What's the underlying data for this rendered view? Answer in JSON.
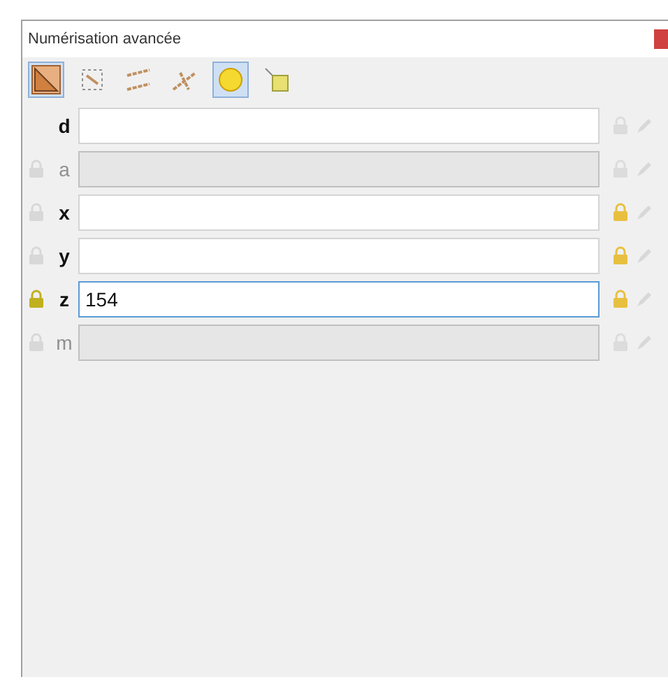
{
  "window": {
    "title": "Numérisation avancée"
  },
  "toolbar": [
    {
      "kind": "ruler",
      "selected": true
    },
    {
      "kind": "dashed",
      "selected": false
    },
    {
      "kind": "parallel",
      "selected": false
    },
    {
      "kind": "perpendicular",
      "selected": false
    },
    {
      "kind": "bulb",
      "selected": true
    },
    {
      "kind": "tag",
      "selected": false
    }
  ],
  "fields": [
    {
      "label": "d",
      "disabled": false,
      "locked": false,
      "focused": false,
      "kind": "plain"
    },
    {
      "label": "a",
      "disabled": true,
      "locked": false,
      "focused": false,
      "kind": "constraint"
    },
    {
      "label": "x",
      "disabled": false,
      "locked": true,
      "focused": false,
      "kind": "constraint"
    },
    {
      "label": "y",
      "disabled": false,
      "locked": true,
      "focused": false,
      "kind": "constraint"
    },
    {
      "label": "z",
      "value": "154",
      "disabled": false,
      "locked": true,
      "focused": true,
      "kind": "active-constraint"
    },
    {
      "label": "m",
      "disabled": true,
      "locked": false,
      "focused": false,
      "kind": "constraint"
    }
  ]
}
